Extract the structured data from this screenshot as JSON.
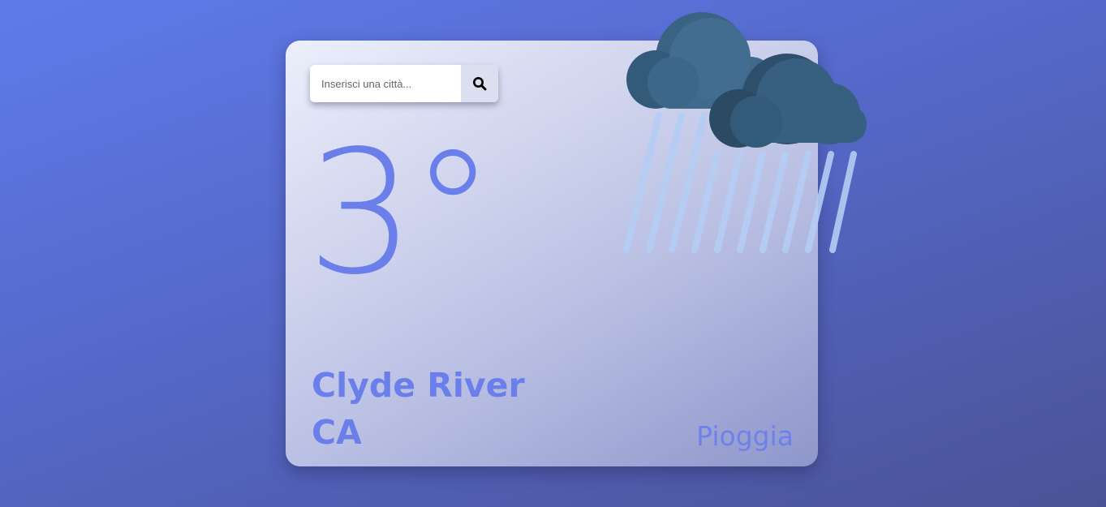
{
  "search": {
    "placeholder": "Inserisci una città...",
    "value": ""
  },
  "weather": {
    "temperature": "3°",
    "city": "Clyde River",
    "country": "CA",
    "condition": "Pioggia",
    "icon": "rain-clouds-icon"
  },
  "colors": {
    "accent": "#6a7fea",
    "cloud_light": "#3f6a8c",
    "cloud_dark": "#2d4f6b",
    "rain": "#b5cdf5"
  }
}
